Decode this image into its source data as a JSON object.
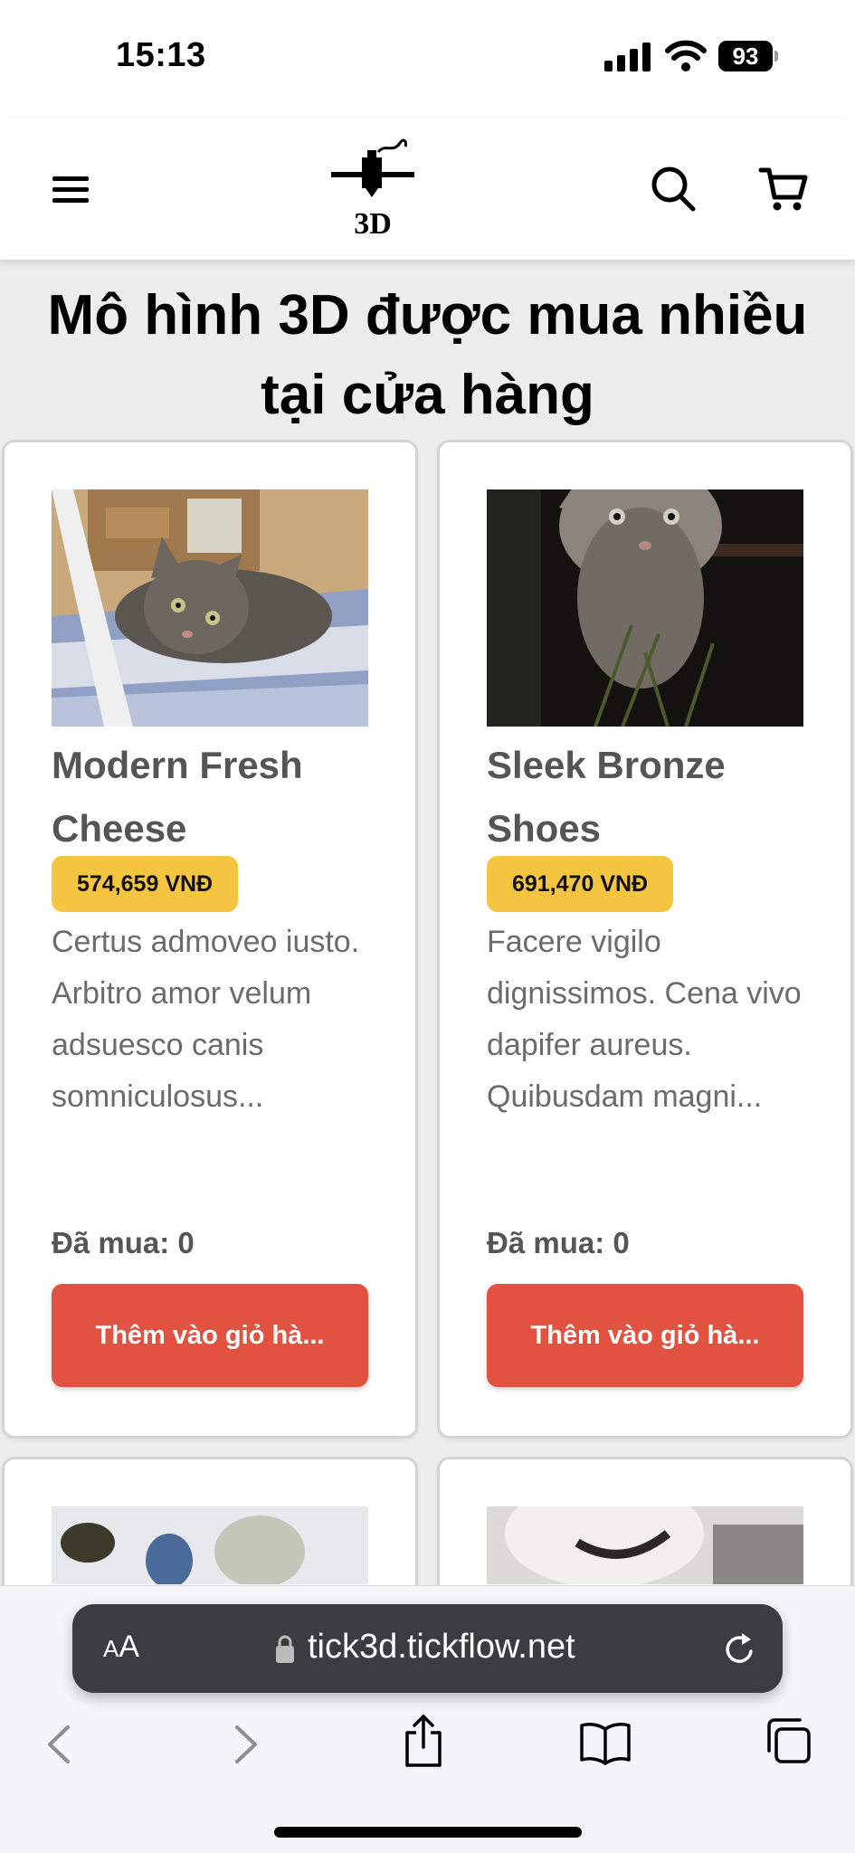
{
  "status_bar": {
    "time": "15:13",
    "battery": "93"
  },
  "header": {
    "logo_text": "3D"
  },
  "page": {
    "title": "Mô hình 3D được mua nhiều tại cửa hàng"
  },
  "products": [
    {
      "name": "Modern Fresh Cheese",
      "price": "574,659 VNĐ",
      "description": "Certus admoveo iusto. Arbitro amor velum adsuesco canis somniculosus...",
      "sold": "Đã mua: 0",
      "button_label": "Thêm vào giỏ hà..."
    },
    {
      "name": "Sleek Bronze Shoes",
      "price": "691,470 VNĐ",
      "description": "Facere vigilo dignissimos. Cena vivo dapifer aureus. Quibusdam magni...",
      "sold": "Đã mua: 0",
      "button_label": "Thêm vào giỏ hà..."
    }
  ],
  "browser": {
    "aa_small": "A",
    "aa_large": "A",
    "url": "tick3d.tickflow.net"
  },
  "colors": {
    "price_badge": "#f5c542",
    "add_button": "#e25240",
    "name_text": "#555555"
  }
}
